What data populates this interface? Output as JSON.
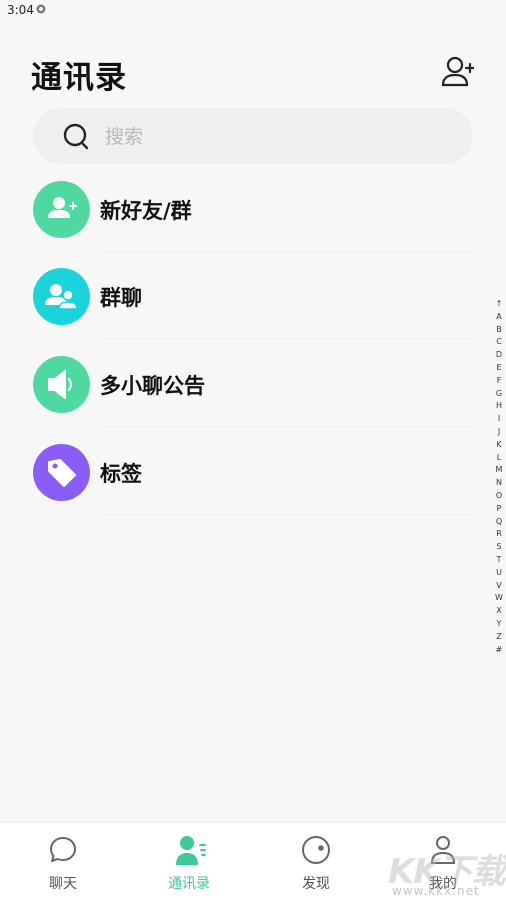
{
  "status": {
    "time": "3:04"
  },
  "header": {
    "title": "通讯录"
  },
  "search": {
    "placeholder": "搜索"
  },
  "menu": {
    "items": [
      {
        "label": "新好友/群",
        "icon": "add-friend-icon",
        "color": "#4fd8a0"
      },
      {
        "label": "群聊",
        "icon": "group-icon",
        "color": "#1bd4db"
      },
      {
        "label": "多小聊公告",
        "icon": "speaker-icon",
        "color": "#4fd8a0"
      },
      {
        "label": "标签",
        "icon": "tag-icon",
        "color": "#8b5cf6"
      }
    ]
  },
  "index": [
    "↑",
    "A",
    "B",
    "C",
    "D",
    "E",
    "F",
    "G",
    "H",
    "I",
    "J",
    "K",
    "L",
    "M",
    "N",
    "O",
    "P",
    "Q",
    "R",
    "S",
    "T",
    "U",
    "V",
    "W",
    "X",
    "Y",
    "Z",
    "#"
  ],
  "tabs": [
    {
      "label": "聊天",
      "icon": "chat-bubble-icon",
      "active": false
    },
    {
      "label": "通讯录",
      "icon": "contacts-icon",
      "active": true
    },
    {
      "label": "发现",
      "icon": "discover-icon",
      "active": false
    },
    {
      "label": "我的",
      "icon": "profile-icon",
      "active": false
    }
  ],
  "watermark": {
    "text": "KK下载",
    "url": "www.kkx.net"
  },
  "colors": {
    "accent": "#3fc99a",
    "purple": "#8b5cf6",
    "cyan": "#1bd4db"
  }
}
